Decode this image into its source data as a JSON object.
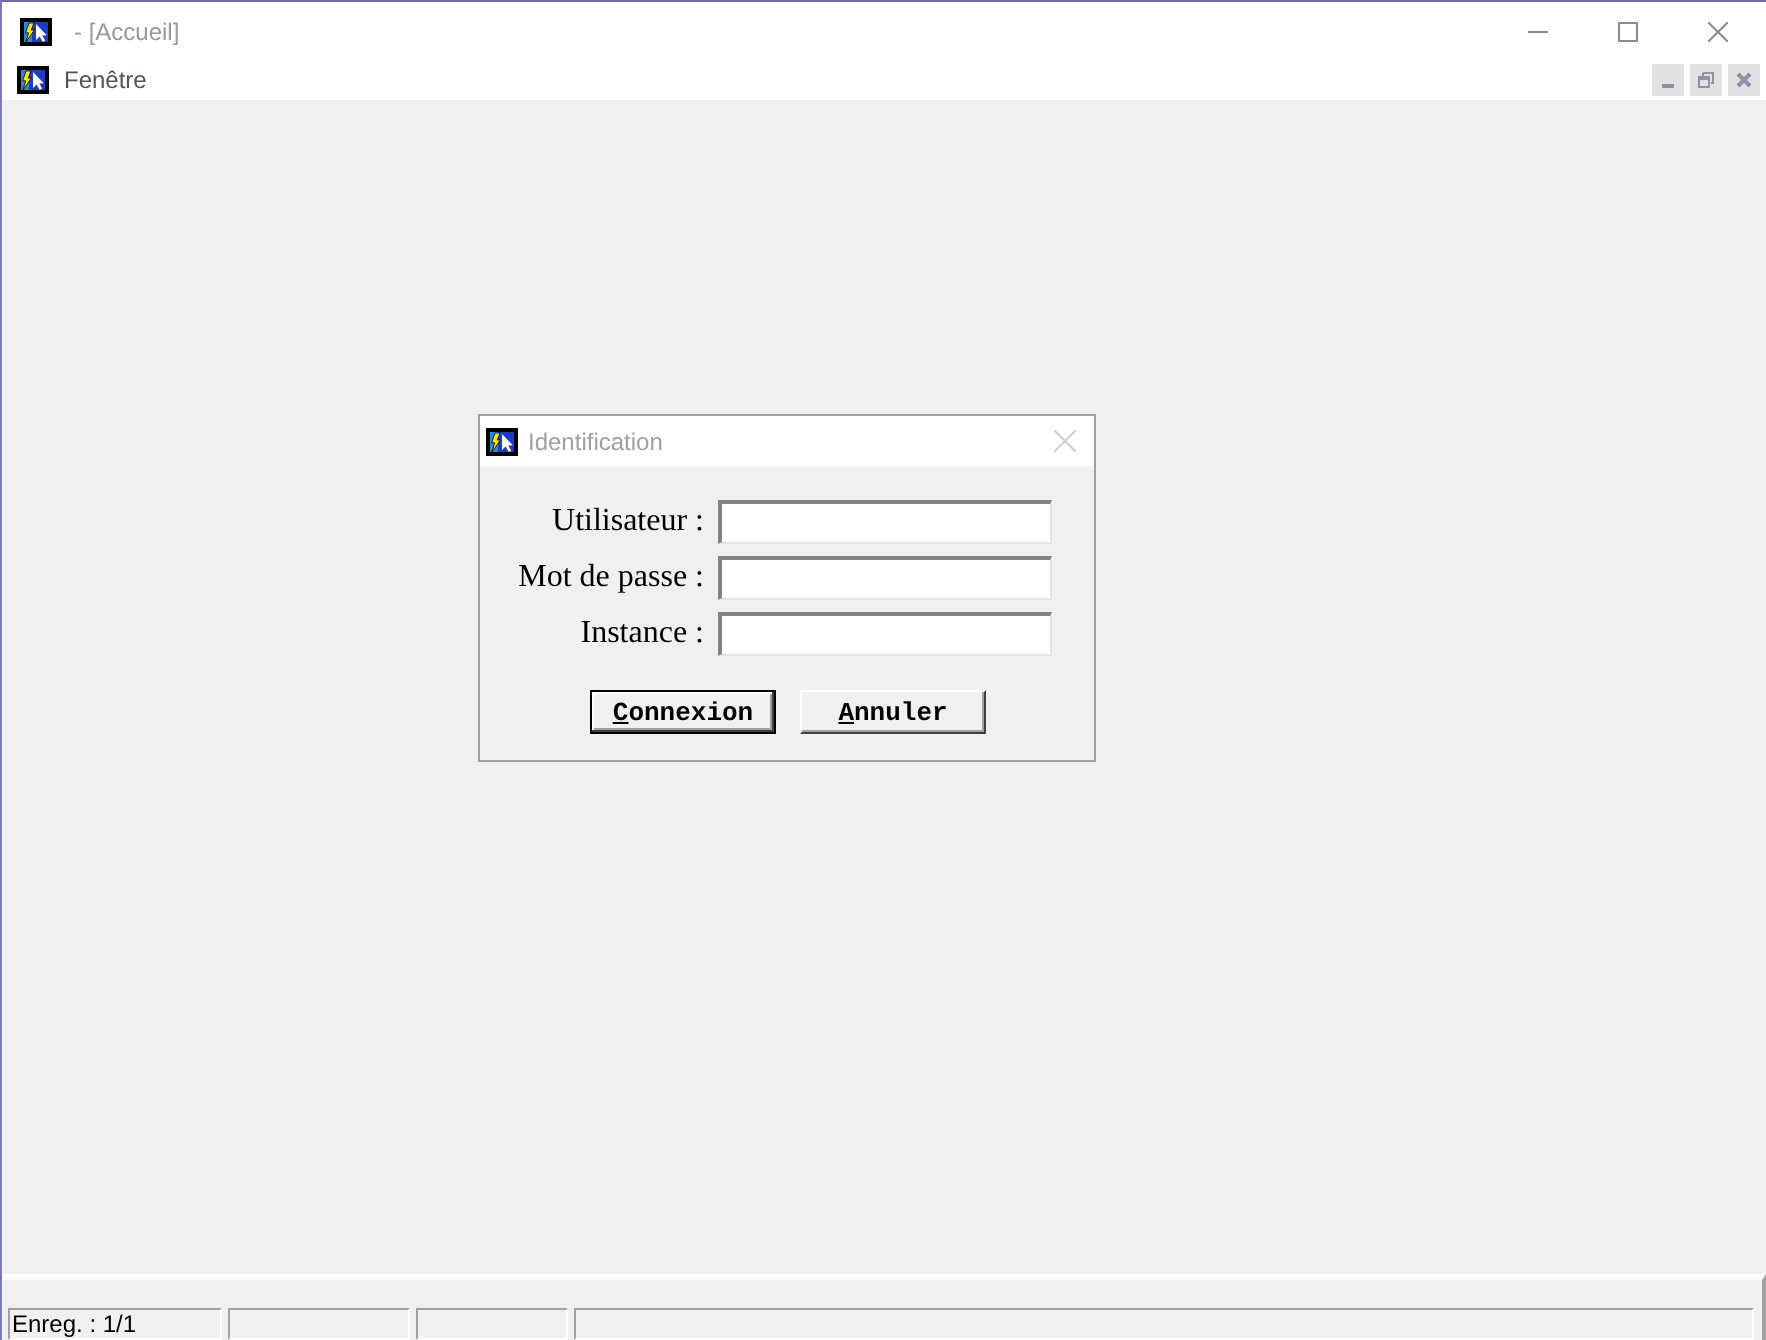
{
  "window": {
    "title": "- [Accueil]",
    "active": false
  },
  "menu_bar": {
    "items": [
      {
        "label": "Fenêtre"
      }
    ]
  },
  "dialog": {
    "title": "Identification",
    "active": false,
    "fields": [
      {
        "label": "Utilisateur :"
      },
      {
        "label": "Mot de passe :"
      },
      {
        "label": "Instance :"
      }
    ],
    "buttons": [
      {
        "label": "Connexion",
        "default": true
      },
      {
        "label": "Annuler",
        "default": false
      }
    ]
  },
  "status_bar": {
    "text": "Enreg. : 1/1"
  }
}
